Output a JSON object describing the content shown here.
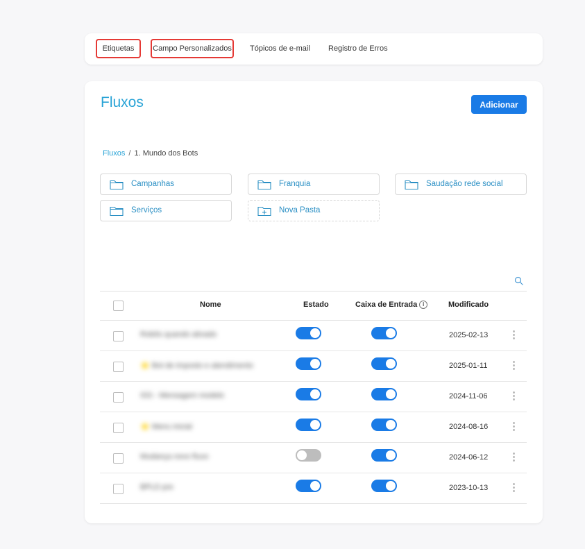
{
  "tabs": [
    {
      "label": "Etiquetas"
    },
    {
      "label": "Campo Personalizados"
    },
    {
      "label": "Tópicos de e-mail"
    },
    {
      "label": "Registro de Erros"
    }
  ],
  "page": {
    "title": "Fluxos",
    "add_button": "Adicionar"
  },
  "breadcrumb": {
    "root": "Fluxos",
    "separator": "/",
    "current": "1. Mundo dos Bots"
  },
  "folders": [
    {
      "label": "Campanhas",
      "icon": "folder-icon"
    },
    {
      "label": "Franquia",
      "icon": "folder-icon"
    },
    {
      "label": "Saudação rede social",
      "icon": "folder-icon"
    },
    {
      "label": "Serviços",
      "icon": "folder-icon"
    },
    {
      "label": "Nova Pasta",
      "icon": "folder-plus-icon"
    }
  ],
  "table": {
    "columns": {
      "name": "Nome",
      "status": "Estado",
      "inbox": "Caixa de Entrada",
      "modified": "Modificado"
    },
    "rows": [
      {
        "name": "Robôs quando ativado",
        "status_on": true,
        "inbox_on": true,
        "modified": "2025-02-13"
      },
      {
        "name": "⭐ Bot de imposto e atendimento",
        "status_on": true,
        "inbox_on": true,
        "modified": "2025-01-11"
      },
      {
        "name": "ISS - Mensagem modelo",
        "status_on": true,
        "inbox_on": true,
        "modified": "2024-11-06"
      },
      {
        "name": "⭐ Menu inicial",
        "status_on": true,
        "inbox_on": true,
        "modified": "2024-08-16"
      },
      {
        "name": "Mudança novo fluxo",
        "status_on": false,
        "inbox_on": true,
        "modified": "2024-06-12"
      },
      {
        "name": "BPLD pre",
        "status_on": true,
        "inbox_on": true,
        "modified": "2023-10-13"
      }
    ]
  },
  "colors": {
    "accent": "#29a3d6",
    "primary_button": "#1a7be6",
    "highlight": "#e53935",
    "toggle_off": "#bdbdbd"
  }
}
